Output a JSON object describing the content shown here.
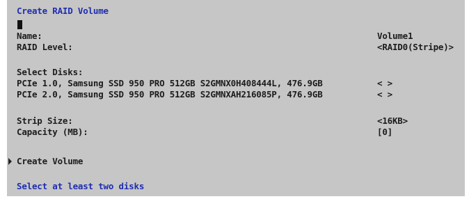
{
  "title": "Create RAID Volume",
  "fields": {
    "name_label": "Name:",
    "name_value": "Volume1",
    "raid_level_label": "RAID Level:",
    "raid_level_value": "<RAID0(Stripe)>"
  },
  "select_disks": {
    "heading": "Select Disks:",
    "disks": [
      {
        "label": "PCIe 1.0, Samsung SSD 950 PRO 512GB S2GMNX0H408444L, 476.9GB",
        "value": "< >"
      },
      {
        "label": "PCIe 2.0, Samsung SSD 950 PRO 512GB S2GMNXAH216085P, 476.9GB",
        "value": "< >"
      }
    ]
  },
  "strip_size": {
    "label": "Strip Size:",
    "value": "<16KB>"
  },
  "capacity": {
    "label": "Capacity (MB):",
    "value": "[0]"
  },
  "action": {
    "label": "Create Volume"
  },
  "status_message": "Select at least two disks",
  "colors": {
    "background": "#c6c6c6",
    "text": "#1c1c1c",
    "highlight": "#1f2eb0"
  }
}
